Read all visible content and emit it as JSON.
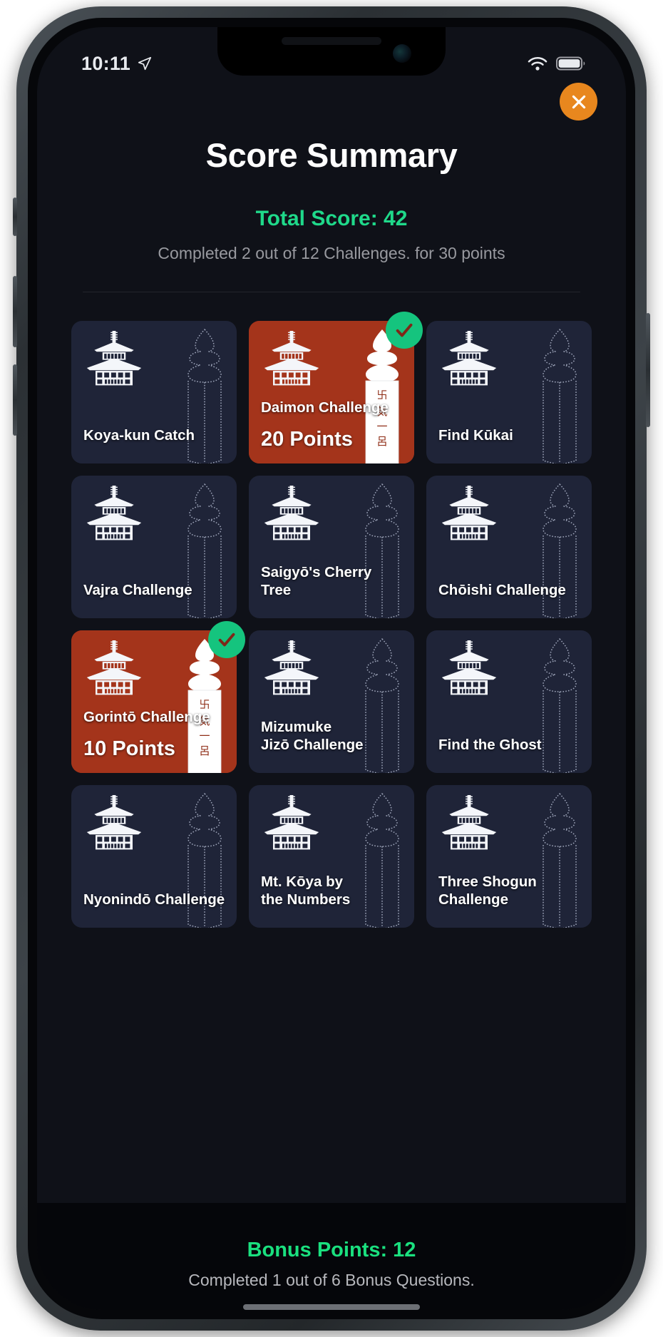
{
  "status_bar": {
    "time": "10:11",
    "location_icon": "location-arrow-icon",
    "wifi_icon": "wifi-icon",
    "battery_icon": "battery-full-icon"
  },
  "header": {
    "close_label": "close-icon",
    "title": "Score Summary",
    "total_score": "Total Score: 42",
    "subtitle": "Completed 2 out of 12 Challenges. for 30 points",
    "accent_green": "#1fd98a",
    "accent_orange": "#e8871e",
    "card_bg": "#1f2438",
    "card_done_bg": "#a4341b",
    "badge_green": "#15c47e"
  },
  "challenges": [
    {
      "label": "Koya-kun Catch",
      "completed": false,
      "points": ""
    },
    {
      "label": "Daimon Challenge",
      "completed": true,
      "points": "20 Points"
    },
    {
      "label": "Find Kūkai",
      "completed": false,
      "points": ""
    },
    {
      "label": "Vajra Challenge",
      "completed": false,
      "points": ""
    },
    {
      "label": "Saigyō's Cherry Tree",
      "completed": false,
      "points": ""
    },
    {
      "label": "Chōishi Challenge",
      "completed": false,
      "points": ""
    },
    {
      "label": "Gorintō Challenge",
      "completed": true,
      "points": "10 Points"
    },
    {
      "label": "Mizumuke\nJizō Challenge",
      "completed": false,
      "points": ""
    },
    {
      "label": "Find the Ghost",
      "completed": false,
      "points": ""
    },
    {
      "label": "Nyonindō Challenge",
      "completed": false,
      "points": ""
    },
    {
      "label": "Mt. Kōya by\nthe Numbers",
      "completed": false,
      "points": ""
    },
    {
      "label": "Three Shogun\nChallenge",
      "completed": false,
      "points": ""
    }
  ],
  "bonus": {
    "points": "Bonus Points: 12",
    "subtitle": "Completed 1 out of 6 Bonus Questions."
  }
}
